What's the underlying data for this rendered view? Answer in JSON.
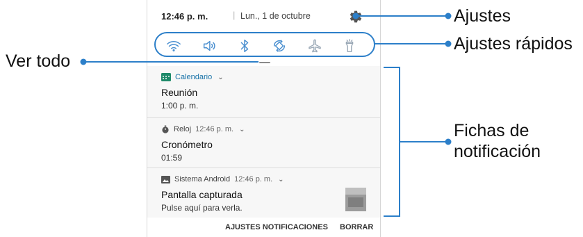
{
  "status": {
    "time": "12:46 p. m.",
    "separator": "|",
    "date": "Lun., 1 de octubre"
  },
  "quick_settings": {
    "icons": [
      "wifi-icon",
      "sound-icon",
      "bluetooth-icon",
      "auto-rotate-icon",
      "airplane-icon",
      "flashlight-icon"
    ]
  },
  "notifications": [
    {
      "app": "Calendario",
      "time": "",
      "title": "Reunión",
      "subtitle": "1:00 p. m."
    },
    {
      "app": "Reloj",
      "time": "12:46 p. m.",
      "title": "Cronómetro",
      "subtitle": "01:59"
    },
    {
      "app": "Sistema Android",
      "time": "12:46 p. m.",
      "title": "Pantalla capturada",
      "subtitle": "Pulse aquí para verla."
    }
  ],
  "footer": {
    "settings_label": "AJUSTES NOTIFICACIONES",
    "clear_label": "BORRAR"
  },
  "callouts": {
    "settings": "Ajustes",
    "quick_settings": "Ajustes rápidos",
    "view_all": "Ver todo",
    "cards_line1": "Fichas de",
    "cards_line2": "notificación"
  },
  "colors": {
    "accent": "#2c7fc9",
    "icon": "#4a8fd0",
    "icon_inactive": "#9aa8b6"
  }
}
